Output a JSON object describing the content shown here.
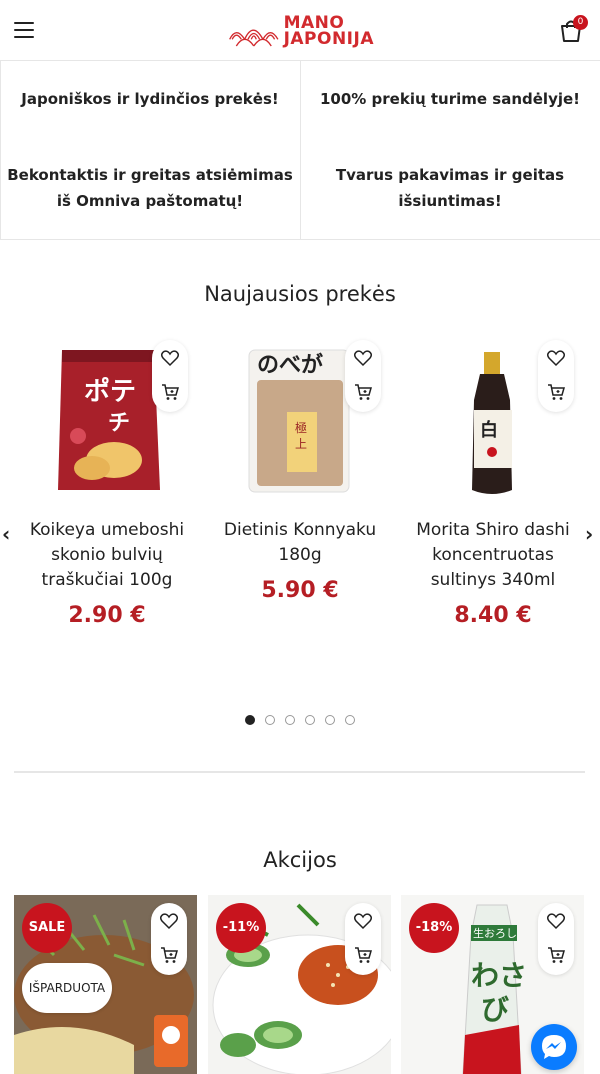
{
  "header": {
    "logo_line1": "MANO",
    "logo_line2": "JAPONIJA",
    "cart_count": "0",
    "brand_color": "#d22a2e"
  },
  "features": [
    {
      "text": "Japoniškos ir lydinčios prekės!"
    },
    {
      "text": "100% prekių turime sandėlyje!"
    },
    {
      "line1": "Bekontaktis ir greitas atsiėmimas",
      "line2": "iš Omniva paštomatų!"
    },
    {
      "line1": "Tvarus pakavimas ir geitas",
      "line2": "išsiuntimas!"
    }
  ],
  "new_products": {
    "title": "Naujausios prekės",
    "items": [
      {
        "title_lines": [
          "Koikeya umeboshi",
          "skonio bulvių",
          "traškučiai 100g"
        ],
        "price": "2.90 €"
      },
      {
        "title_lines": [
          "Dietinis Konnyaku",
          "180g"
        ],
        "price": "5.90 €"
      },
      {
        "title_lines": [
          "Morita Shiro dashi",
          "koncentruotas",
          "sultinys 340ml"
        ],
        "price": "8.40 €"
      }
    ],
    "active_dot": 0,
    "dot_count": 6
  },
  "sales": {
    "title": "Akcijos",
    "items": [
      {
        "badge": "SALE",
        "status": "IŠPARDUOTA"
      },
      {
        "badge": "-11%"
      },
      {
        "badge": "-18%"
      }
    ]
  },
  "colors": {
    "price": "#b51e24",
    "badge": "#c8141e",
    "messenger": "#0a7cff"
  }
}
